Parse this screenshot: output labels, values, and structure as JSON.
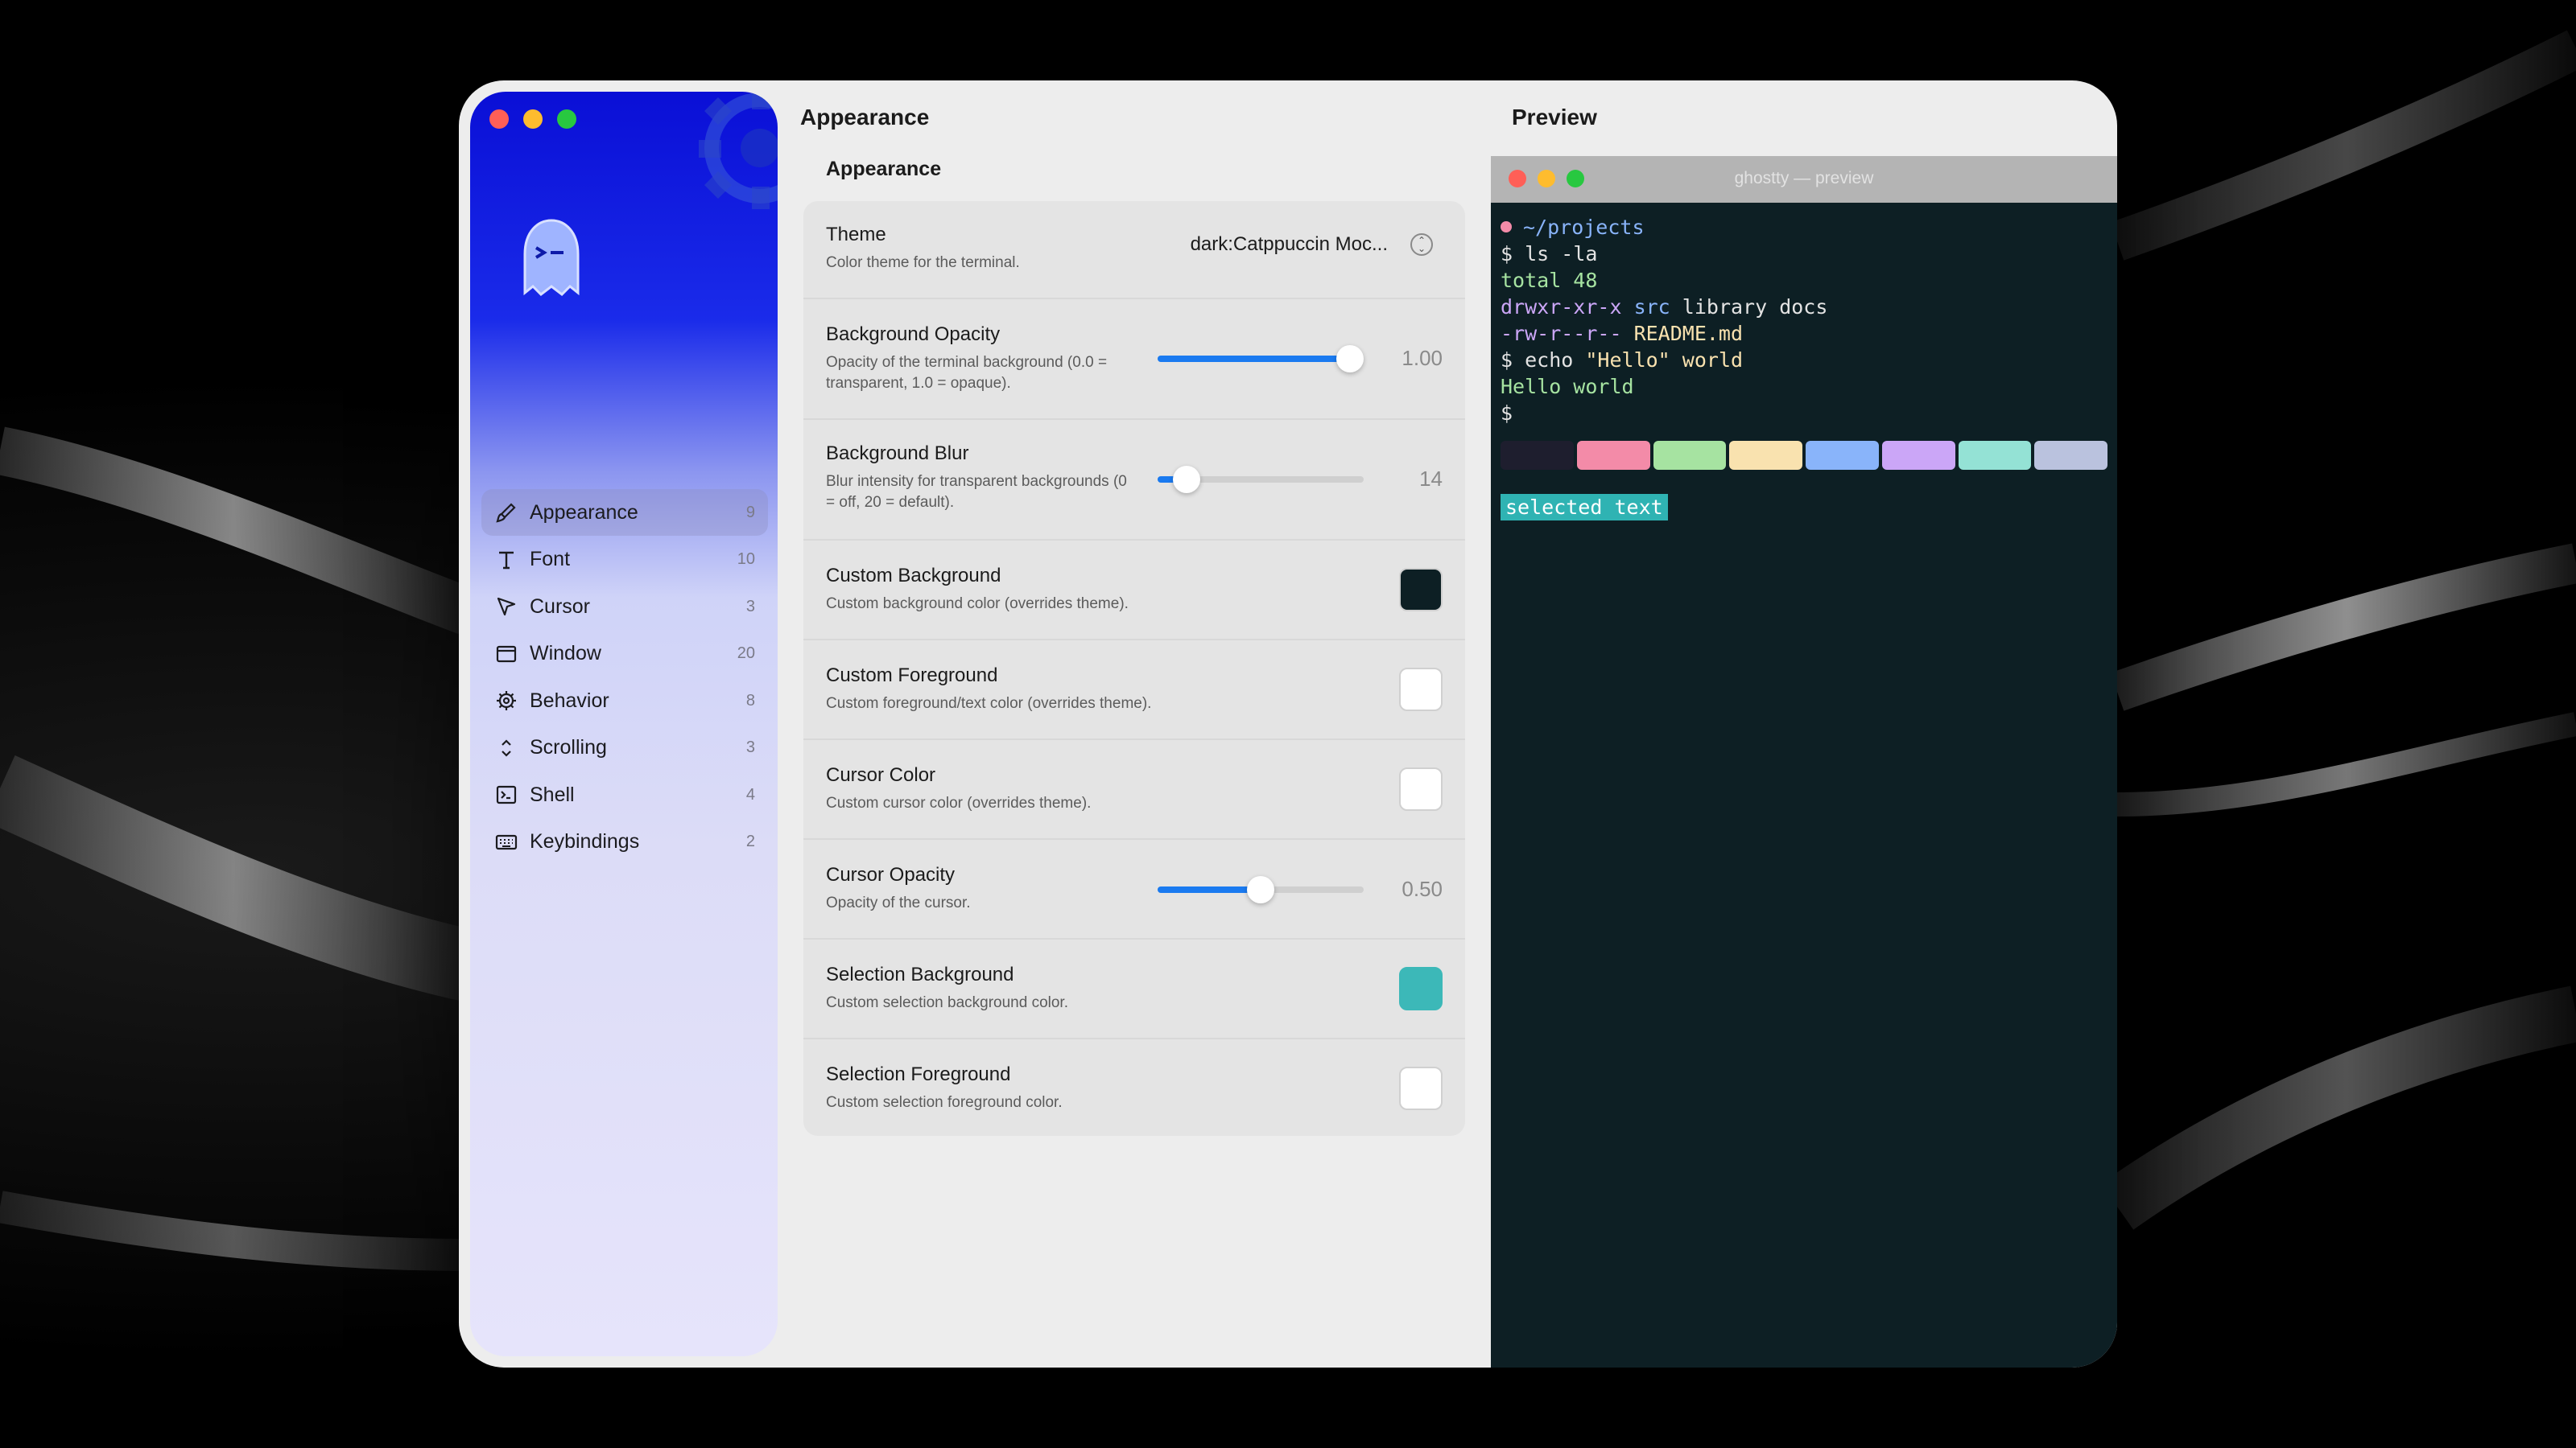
{
  "sidebar": {
    "items": [
      {
        "label": "Appearance",
        "count": "9",
        "icon": "paintbrush-icon"
      },
      {
        "label": "Font",
        "count": "10",
        "icon": "text-icon"
      },
      {
        "label": "Cursor",
        "count": "3",
        "icon": "cursor-icon"
      },
      {
        "label": "Window",
        "count": "20",
        "icon": "window-icon"
      },
      {
        "label": "Behavior",
        "count": "8",
        "icon": "gear-icon"
      },
      {
        "label": "Scrolling",
        "count": "3",
        "icon": "scroll-chevrons-icon"
      },
      {
        "label": "Shell",
        "count": "4",
        "icon": "terminal-icon"
      },
      {
        "label": "Keybindings",
        "count": "2",
        "icon": "keyboard-icon"
      }
    ],
    "active": "Appearance"
  },
  "settings": {
    "title": "Appearance",
    "section": "Appearance",
    "rows": {
      "theme": {
        "title": "Theme",
        "desc": "Color theme for the terminal.",
        "value": "dark:Catppuccin Moc..."
      },
      "bg_opacity": {
        "title": "Background Opacity",
        "desc": "Opacity of the terminal background (0.0 = transparent, 1.0 = opaque).",
        "value": "1.00",
        "fraction": 1.0
      },
      "bg_blur": {
        "title": "Background Blur",
        "desc": "Blur intensity for transparent backgrounds (0 = off, 20 = default).",
        "value": "14",
        "fraction": 0.14
      },
      "custom_bg": {
        "title": "Custom Background",
        "desc": "Custom background color (overrides theme).",
        "color": "#0d1f24"
      },
      "custom_fg": {
        "title": "Custom Foreground",
        "desc": "Custom foreground/text color (overrides theme).",
        "color": "#ffffff"
      },
      "cursor_color": {
        "title": "Cursor Color",
        "desc": "Custom cursor color (overrides theme).",
        "color": "#ffffff"
      },
      "cursor_opacity": {
        "title": "Cursor Opacity",
        "desc": "Opacity of the cursor.",
        "value": "0.50",
        "fraction": 0.5
      },
      "sel_bg": {
        "title": "Selection Background",
        "desc": "Custom selection background color.",
        "color": "#3cb8b8"
      },
      "sel_fg": {
        "title": "Selection Foreground",
        "desc": "Custom selection foreground color.",
        "color": "#ffffff"
      }
    }
  },
  "preview": {
    "title": "Preview",
    "window_title": "ghostty — preview",
    "lines": {
      "cwd": "~/projects",
      "l1_prompt": "$ ",
      "l1_cmd": "ls -la",
      "l2": "total 48",
      "l3_perm": "drwxr-xr-x ",
      "l3_dir": "src",
      "l3_rest": " library docs",
      "l4_perm": "-rw-r--r-- ",
      "l4_file": "README.md",
      "l5_prompt": "$ ",
      "l5_cmd": "echo ",
      "l5_str": "\"Hello\"",
      "l5_rest": " world",
      "l6": "Hello world",
      "l7": "$"
    },
    "palette": [
      "#1e1e2e",
      "#f38ba8",
      "#a6e3a1",
      "#f9e2af",
      "#89b4fa",
      "#cba6f7",
      "#94e2d5",
      "#bac2de"
    ],
    "selected_text": "selected text"
  },
  "colors": {
    "accent": "#1a7af0",
    "sidebar_top": "#0a0fd6"
  }
}
